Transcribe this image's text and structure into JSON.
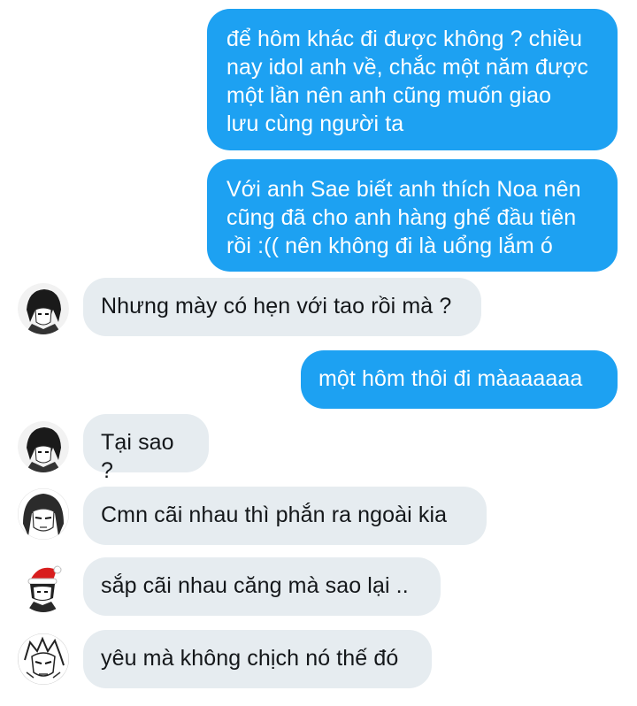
{
  "conversation": {
    "messages": [
      {
        "direction": "outgoing",
        "text": "để hôm khác đi được không ? chiều\nnay idol anh về, chắc một năm được\nmột lần nên anh cũng muốn giao\nlưu cùng người ta"
      },
      {
        "direction": "outgoing",
        "text": "Với anh Sae biết anh thích Noa nên\ncũng đã cho anh hàng ghế đầu tiên\nrồi :(( nên không đi là uổng lắm ó"
      },
      {
        "direction": "incoming",
        "avatar": "avatar-dark-hair-icon",
        "text": "Nhưng mày có hẹn với tao rồi mà ?"
      },
      {
        "direction": "outgoing",
        "text": "một hôm thôi đi màaaaaaa"
      },
      {
        "direction": "incoming",
        "avatar": "avatar-dark-hair-icon",
        "text": "Tại sao ?"
      },
      {
        "direction": "incoming",
        "avatar": "avatar-long-hair-icon",
        "text": "Cmn cãi nhau thì phắn ra ngoài kia"
      },
      {
        "direction": "incoming",
        "avatar": "avatar-santa-hat-icon",
        "text": "sắp cãi nhau căng mà sao lại .."
      },
      {
        "direction": "incoming",
        "avatar": "avatar-sketch-icon",
        "text": "yêu mà không chịch nó thế đó"
      }
    ]
  },
  "colors": {
    "outgoing_bubble": "#1da1f2",
    "incoming_bubble": "#e6ecf0",
    "outgoing_text": "#ffffff",
    "incoming_text": "#14171a"
  }
}
